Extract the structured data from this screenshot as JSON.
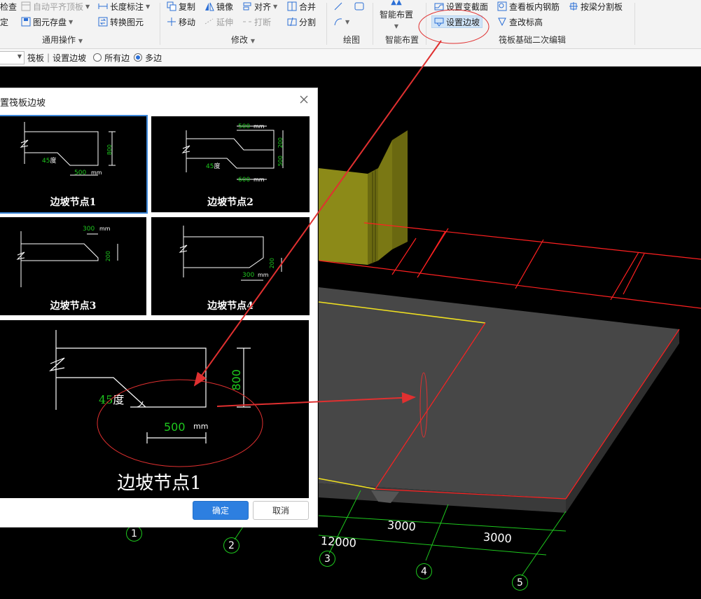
{
  "ribbon": {
    "row1": {
      "check_label": "检查",
      "auto_flush_label": "自动平齐顶板",
      "length_dim_label": "长度标注",
      "copy_label": "复制",
      "mirror_label": "镜像",
      "align_label": "对齐",
      "merge_label": "合并",
      "set_var_section_label": "设置变截面",
      "view_rebar_label": "查看板内钢筋",
      "split_by_beam_label": "按梁分割板"
    },
    "row2": {
      "attr_label": "定",
      "save_element_label": "图元存盘",
      "convert_element_label": "转换图元",
      "move_label": "移动",
      "extend_label": "延伸",
      "break_label": "打断",
      "split_label": "分割",
      "set_slope_label": "设置边坡",
      "change_elev_label": "查改标高"
    },
    "smart_layout_label": "智能布置",
    "groups": {
      "general": "通用操作",
      "modify": "修改",
      "draw": "绘图",
      "smart": "智能布置",
      "raft": "筏板基础二次编辑"
    }
  },
  "propbar": {
    "element_label": "筏板",
    "divider": "|",
    "command_label": "设置边坡",
    "option_all_edges": "所有边",
    "option_multi_edges": "多边",
    "selected_option": "多边"
  },
  "dialog": {
    "title": "置筏板边坡",
    "nodes": [
      {
        "label": "边坡节点1",
        "angle": "45",
        "angle_unit": "度",
        "width": "500",
        "width_unit": "mm",
        "height": "800"
      },
      {
        "label": "边坡节点2",
        "angle": "45",
        "angle_unit": "度",
        "top": "500",
        "top_unit": "mm",
        "step": "200",
        "height": "500",
        "bottom": "600",
        "bottom_unit": "mm"
      },
      {
        "label": "边坡节点3",
        "width": "300",
        "width_unit": "mm",
        "height": "200"
      },
      {
        "label": "边坡节点4",
        "width": "300",
        "width_unit": "mm",
        "height": "200"
      }
    ],
    "selected_node": "边坡节点1",
    "preview": {
      "label": "边坡节点1",
      "angle": "45",
      "angle_unit": "度",
      "width": "500",
      "width_unit": "mm",
      "height": "800"
    },
    "ok_label": "确定",
    "cancel_label": "取消"
  },
  "canvas": {
    "axis_labels": [
      "1",
      "2",
      "3",
      "4",
      "5"
    ],
    "dimension_labels": [
      "12000",
      "3000",
      "3000"
    ]
  },
  "colors": {
    "grid_red": "#ff2020",
    "slab": "#4a4a4a",
    "wall": "#8a8a14",
    "dim_green": "#1ec81e",
    "annotation_red": "#e03030",
    "highlight_blue": "#2d7fe0"
  }
}
